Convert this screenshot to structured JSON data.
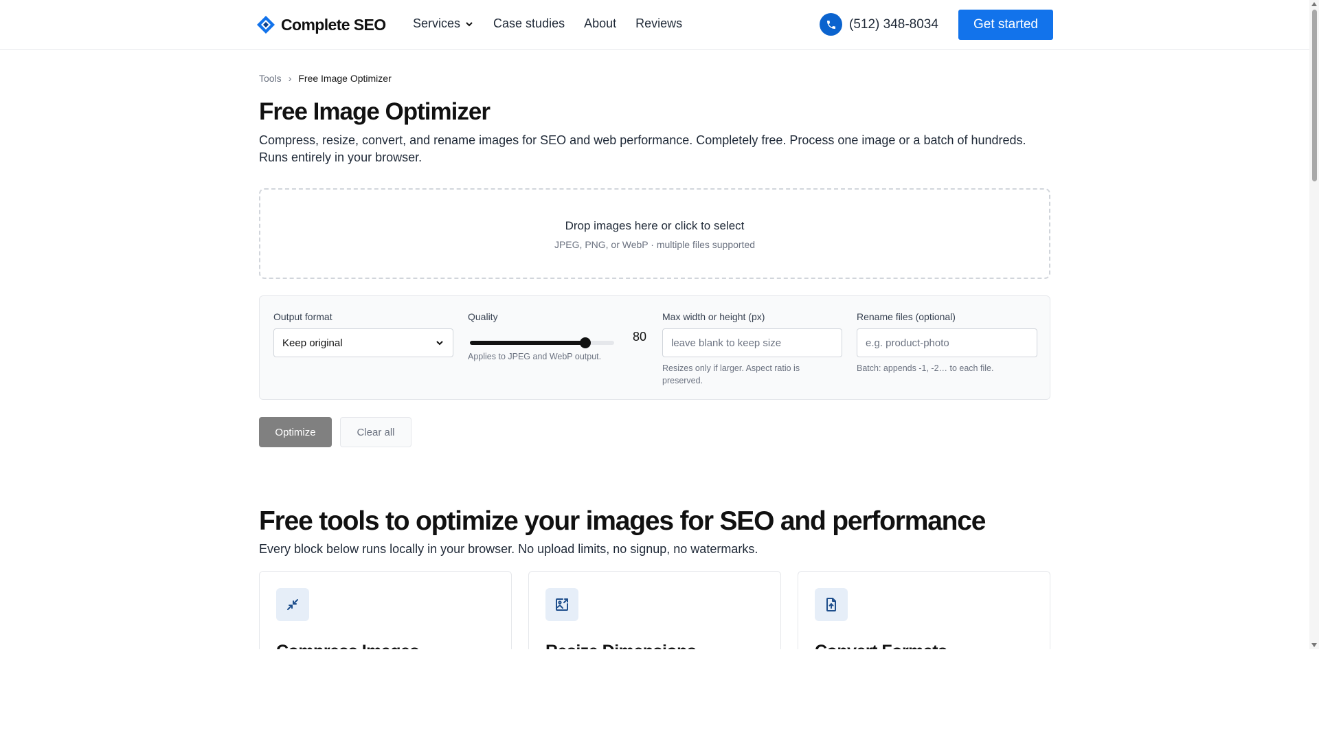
{
  "header": {
    "logo_text": "Complete SEO",
    "nav": [
      {
        "label": "Services",
        "has_dropdown": true
      },
      {
        "label": "Case studies"
      },
      {
        "label": "About"
      },
      {
        "label": "Reviews"
      }
    ],
    "phone": "(512) 348-8034",
    "cta_label": "Get started"
  },
  "breadcrumb": {
    "root": "Tools",
    "separator": "›",
    "current": "Free Image Optimizer"
  },
  "page": {
    "title": "Free Image Optimizer",
    "description_line1": "Compress, resize, convert, and rename images for SEO and web performance. Completely free. Process one image or a batch of hundreds.",
    "description_line2": "Runs entirely in your browser."
  },
  "dropzone": {
    "title": "Drop images here or click to select",
    "subtitle": "JPEG, PNG, or WebP · multiple files supported"
  },
  "options": {
    "output_format": {
      "label": "Output format",
      "value": "Keep original"
    },
    "quality": {
      "label": "Quality",
      "value": 80,
      "min": 0,
      "max": 100,
      "hint": "Applies to JPEG and WebP output."
    },
    "max_dimension": {
      "label": "Max width or height (px)",
      "placeholder": "leave blank to keep size",
      "hint_line1": "Resizes only if larger. Aspect ratio is",
      "hint_line2": "preserved."
    },
    "rename": {
      "label": "Rename files (optional)",
      "placeholder": "e.g. product-photo",
      "hint": "Batch: appends -1, -2… to each file."
    }
  },
  "actions": {
    "optimize_label": "Optimize",
    "clear_label": "Clear all"
  },
  "tools_section": {
    "title": "Free tools to optimize your images for SEO and performance",
    "subtitle": "Every block below runs locally in your browser. No upload limits, no signup, no watermarks.",
    "cards": [
      {
        "title": "Compress Images",
        "icon": "compress-icon"
      },
      {
        "title": "Resize Dimensions",
        "icon": "image-resize-icon"
      },
      {
        "title": "Convert Formats",
        "icon": "file-convert-icon"
      }
    ]
  },
  "colors": {
    "brand_blue": "#1273eb",
    "phone_circle": "#0b63ce",
    "optimize_disabled": "#808080"
  }
}
